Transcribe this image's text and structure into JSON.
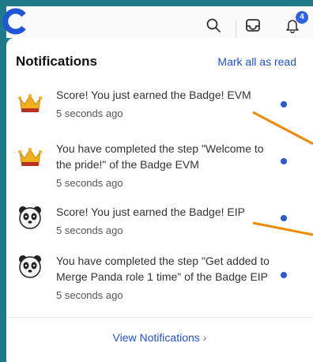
{
  "header": {
    "logo_icon": "brand-c-logo",
    "icons": [
      "search-icon",
      "inbox-icon",
      "bell-icon"
    ],
    "notification_count": "4"
  },
  "panel": {
    "title": "Notifications",
    "mark_all_label": "Mark all as read",
    "items": [
      {
        "icon": "crown-icon",
        "message": "Score! You just earned the Badge! EVM",
        "time": "5 seconds ago",
        "unread": true
      },
      {
        "icon": "crown-icon",
        "message": "You have completed the step \"Welcome to the pride!\" of the Badge EVM",
        "time": "5 seconds ago",
        "unread": true
      },
      {
        "icon": "panda-icon",
        "message": "Score! You just earned the Badge! EIP",
        "time": "5 seconds ago",
        "unread": true
      },
      {
        "icon": "panda-icon",
        "message": "You have completed the step \"Get added to Merge Panda role 1 time\" of the Badge EIP",
        "time": "5 seconds ago",
        "unread": true
      }
    ],
    "view_all_label": "View Notifications"
  },
  "colors": {
    "background": "#1f7a8c",
    "accent": "#2152c9",
    "unread_dot": "#2e5ad0",
    "annotation_stroke": "#f08a00"
  }
}
